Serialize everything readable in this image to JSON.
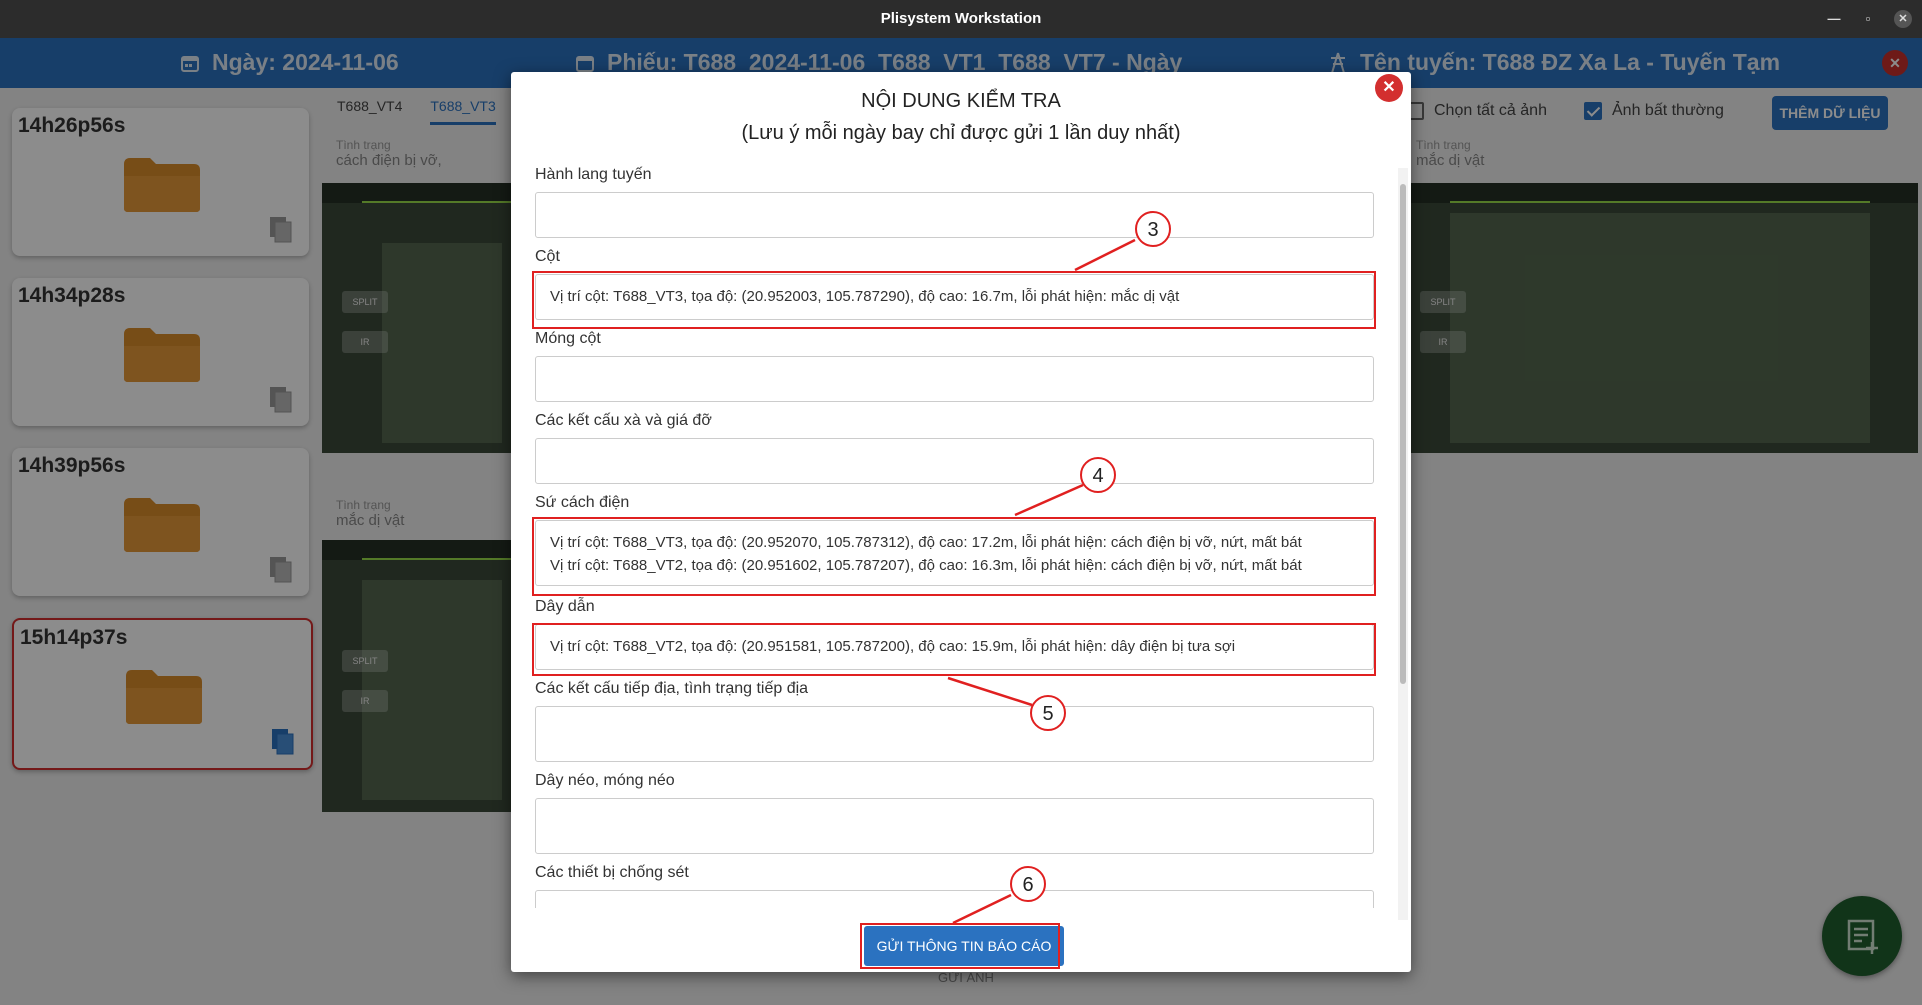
{
  "window": {
    "title": "Plisystem Workstation"
  },
  "header": {
    "date": "Ngày: 2024-11-06",
    "ticket": "Phiếu: T688_2024-11-06_T688_VT1_T688_VT7 - Ngày",
    "route": "Tên tuyến: T688 ĐZ Xa La - Tuyến Tạm"
  },
  "folders": [
    {
      "time": "14h26p56s"
    },
    {
      "time": "14h34p28s"
    },
    {
      "time": "14h39p56s"
    },
    {
      "time": "15h14p37s"
    }
  ],
  "tabs": [
    "T688_VT4",
    "T688_VT3"
  ],
  "status_label": "Tình trạng",
  "status_values": [
    "cách điện bị vỡ,",
    "mắc dị vật",
    "mắc dị vật"
  ],
  "right_controls": {
    "select_all": "Chọn tất cả ảnh",
    "abnormal": "Ảnh bất thường",
    "add_data": "THÊM DỮ LIỆU"
  },
  "bg_send_label": "GỬI ẢNH",
  "modal": {
    "title": "NỘI DUNG KIỂM TRA",
    "subtitle": "(Lưu ý mỗi ngày bay chỉ được gửi 1 lần duy nhất)",
    "fields": [
      {
        "label": "Hành lang tuyến",
        "value": ""
      },
      {
        "label": "Cột",
        "value": "Vị trí cột: T688_VT3, tọa độ: (20.952003, 105.787290), độ cao: 16.7m, lỗi phát hiện: mắc dị vật"
      },
      {
        "label": "Móng cột",
        "value": ""
      },
      {
        "label": "Các kết cấu xà và giá đỡ",
        "value": ""
      },
      {
        "label": "Sứ cách điện",
        "value": "Vị trí cột: T688_VT3, tọa độ: (20.952070, 105.787312), độ cao: 17.2m, lỗi phát hiện: cách điện bị vỡ, nứt, mất bát\nVị trí cột: T688_VT2, tọa độ: (20.951602, 105.787207), độ cao: 16.3m, lỗi phát hiện: cách điện bị vỡ, nứt, mất bát"
      },
      {
        "label": "Dây dẫn",
        "value": "Vị trí cột: T688_VT2, tọa độ: (20.951581, 105.787200), độ cao: 15.9m, lỗi phát hiện: dây điện bị tưa sợi"
      },
      {
        "label": "Các kết cấu tiếp địa, tình trạng tiếp địa",
        "value": ""
      },
      {
        "label": "Dây néo, móng néo",
        "value": ""
      },
      {
        "label": "Các thiết bị chống sét",
        "value": ""
      }
    ],
    "submit_label": "GỬI THÔNG TIN BÁO CÁO"
  },
  "callouts": [
    "3",
    "4",
    "5",
    "6"
  ],
  "colors": {
    "primary": "#2b72c0",
    "accent_red": "#e02020",
    "folder": "#d98c2b"
  }
}
